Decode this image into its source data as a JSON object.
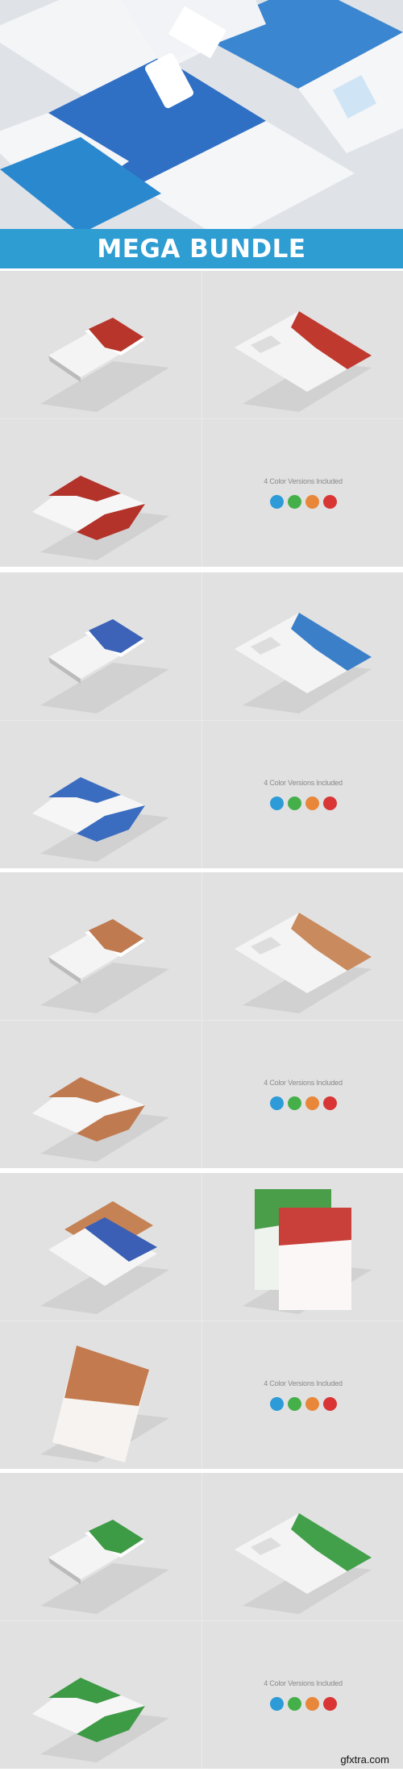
{
  "banner": {
    "title": "MEGA BUNDLE",
    "color": "#2e9dd2"
  },
  "palette": [
    "#2d9bd8",
    "#45b04a",
    "#e8873a",
    "#d93535"
  ],
  "colors_label": "4 Color Versions Included",
  "sections": [
    {
      "mockups": [
        {
          "kind": "bifold-closed",
          "color": "#b8352b"
        },
        {
          "kind": "bifold-open",
          "color": "#c0392f"
        },
        {
          "kind": "bifold-inside",
          "color": "#b3322a"
        }
      ]
    },
    {
      "mockups": [
        {
          "kind": "trifold-closed",
          "color": "#3c63b8"
        },
        {
          "kind": "trifold-open",
          "color": "#3b7fc9"
        },
        {
          "kind": "trifold-inside",
          "color": "#3a6cc0"
        }
      ]
    },
    {
      "mockups": [
        {
          "kind": "trifold-closed",
          "color": "#c07a50"
        },
        {
          "kind": "trifold-open",
          "color": "#c98a5e"
        },
        {
          "kind": "trifold-inside",
          "color": "#c07a50"
        }
      ]
    },
    {
      "mockups": [
        {
          "kind": "flyer-stack",
          "color": "#3a5fb5",
          "color2": "#c58254"
        },
        {
          "kind": "flyer-pair",
          "color": "#4a9e4a",
          "color2": "#c9403a"
        },
        {
          "kind": "flyer-float",
          "color": "#c27a4e"
        }
      ]
    },
    {
      "mockups": [
        {
          "kind": "trifold-closed",
          "color": "#3d9a45"
        },
        {
          "kind": "trifold-open",
          "color": "#43a04a"
        },
        {
          "kind": "trifold-inside",
          "color": "#3d9a45"
        }
      ]
    }
  ],
  "watermark": "gfxtra.com"
}
